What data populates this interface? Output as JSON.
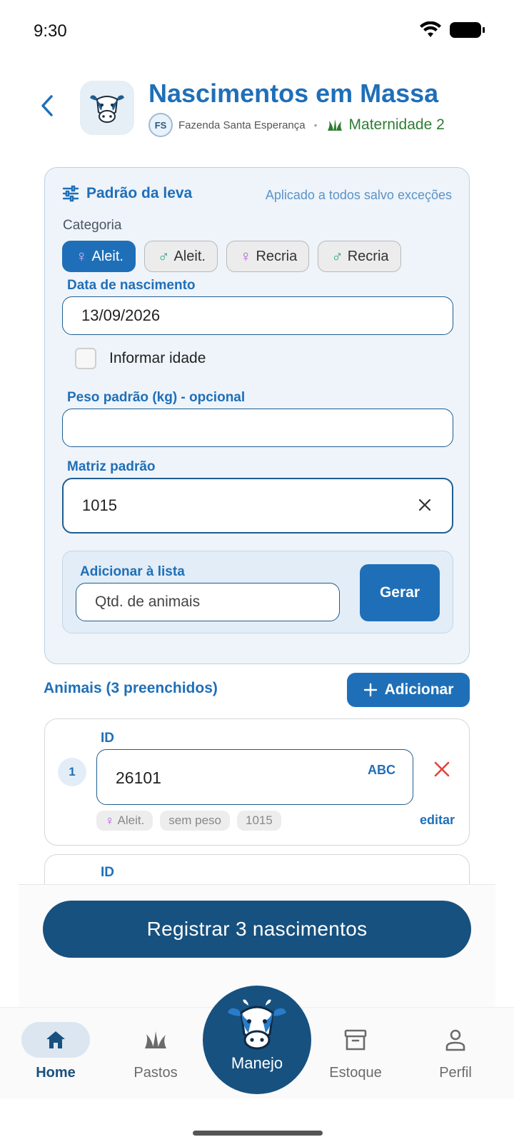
{
  "status": {
    "time": "9:30"
  },
  "header": {
    "title": "Nascimentos em Massa",
    "farm_badge": "FS",
    "farm_name": "Fazenda Santa Esperança",
    "separator": "•",
    "lot_name": "Maternidade 2"
  },
  "pattern": {
    "title": "Padrão da leva",
    "hint": "Aplicado a todos salvo exceções",
    "category_label": "Categoria",
    "categories": [
      {
        "symbol": "♀",
        "label": "Aleit.",
        "selected": true
      },
      {
        "symbol": "♂",
        "label": "Aleit.",
        "selected": false
      },
      {
        "symbol": "♀",
        "label": "Recria",
        "selected": false
      },
      {
        "symbol": "♂",
        "label": "Recria",
        "selected": false
      }
    ],
    "birth_date_label": "Data de nascimento",
    "birth_date_value": "13/09/2026",
    "inform_age_label": "Informar idade",
    "weight_label": "Peso padrão (kg) - opcional",
    "weight_value": "",
    "mother_label": "Matriz padrão",
    "mother_value": "1015",
    "add_list_label": "Adicionar à lista",
    "qty_placeholder": "Qtd. de animais",
    "generate_label": "Gerar"
  },
  "animals": {
    "title": "Animais (3 preenchidos)",
    "add_label": "Adicionar",
    "items": [
      {
        "number": "1",
        "id_label": "ID",
        "id_value": "26101",
        "mode": "ABC",
        "tag_category": "Aleit.",
        "tag_weight": "sem peso",
        "tag_mother": "1015",
        "edit_label": "editar"
      },
      {
        "id_label": "ID"
      }
    ]
  },
  "register_label": "Registrar 3 nascimentos",
  "nav": {
    "home": "Home",
    "pastures": "Pastos",
    "center": "Manejo",
    "stock": "Estoque",
    "profile": "Perfil"
  },
  "colors": {
    "primary": "#1f6fb8",
    "dark_primary": "#17517f",
    "female": "#b35ad6",
    "male": "#1aa58a",
    "lot_green": "#2e7d32",
    "danger": "#e0443e"
  }
}
